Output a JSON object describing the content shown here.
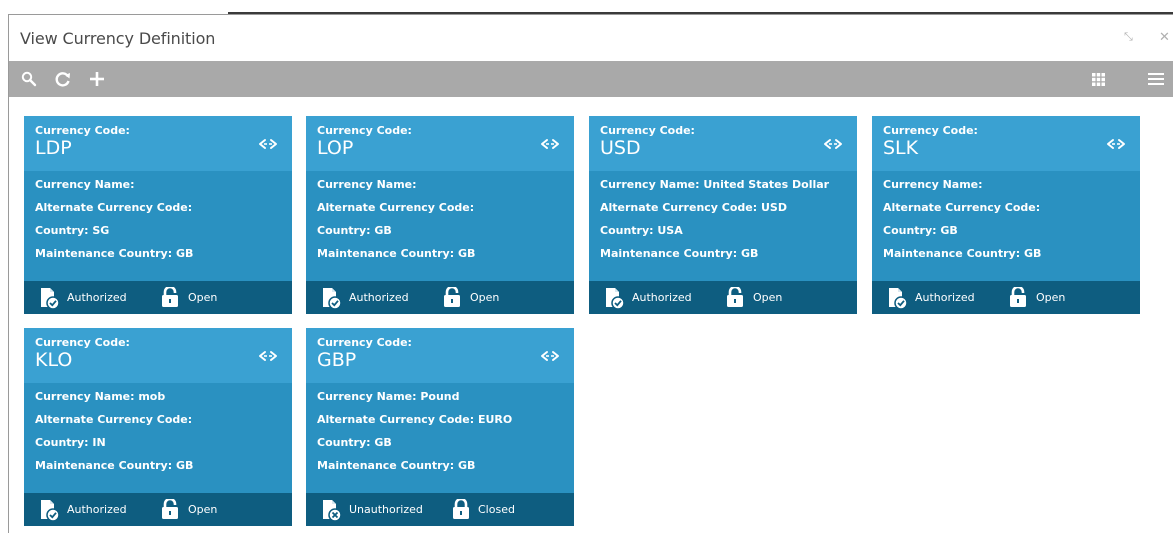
{
  "window": {
    "title": "View Currency Definition",
    "minimize_glyph": "⤡",
    "close_glyph": "✕"
  },
  "toolbar": {
    "search_icon": "search-icon",
    "refresh_icon": "refresh-icon",
    "add_icon": "add-icon",
    "grid_view_icon": "grid-view-icon",
    "list_view_icon": "list-view-icon"
  },
  "labels": {
    "currency_code": "Currency Code:",
    "currency_name": "Currency Name:",
    "alternate_code": "Alternate Currency Code:",
    "country": "Country:",
    "maintenance_country": "Maintenance Country:"
  },
  "cards": [
    {
      "code": "LDP",
      "currency_name": "Currency Name:",
      "alternate_code": "Alternate Currency Code:",
      "country": "Country: SG",
      "maintenance_country": "Maintenance Country: GB",
      "auth_status": "Authorized",
      "record_status": "Open"
    },
    {
      "code": "LOP",
      "currency_name": "Currency Name:",
      "alternate_code": "Alternate Currency Code:",
      "country": "Country: GB",
      "maintenance_country": "Maintenance Country: GB",
      "auth_status": "Authorized",
      "record_status": "Open"
    },
    {
      "code": "USD",
      "currency_name": "Currency Name: United States Dollar",
      "alternate_code": "Alternate Currency Code: USD",
      "country": "Country: USA",
      "maintenance_country": "Maintenance Country: GB",
      "auth_status": "Authorized",
      "record_status": "Open"
    },
    {
      "code": "SLK",
      "currency_name": "Currency Name:",
      "alternate_code": "Alternate Currency Code:",
      "country": "Country: GB",
      "maintenance_country": "Maintenance Country: GB",
      "auth_status": "Authorized",
      "record_status": "Open"
    },
    {
      "code": "KLO",
      "currency_name": "Currency Name: mob",
      "alternate_code": "Alternate Currency Code:",
      "country": "Country: IN",
      "maintenance_country": "Maintenance Country: GB",
      "auth_status": "Authorized",
      "record_status": "Open"
    },
    {
      "code": "GBP",
      "currency_name": "Currency Name: Pound",
      "alternate_code": "Alternate Currency Code: EURO",
      "country": "Country: GB",
      "maintenance_country": "Maintenance Country: GB",
      "auth_status": "Unauthorized",
      "record_status": "Closed"
    }
  ],
  "colors": {
    "toolbar": "#a9a9a9",
    "card_head": "#3aa1d2",
    "card_body": "#2a91c1",
    "card_foot": "#0e5d80"
  }
}
